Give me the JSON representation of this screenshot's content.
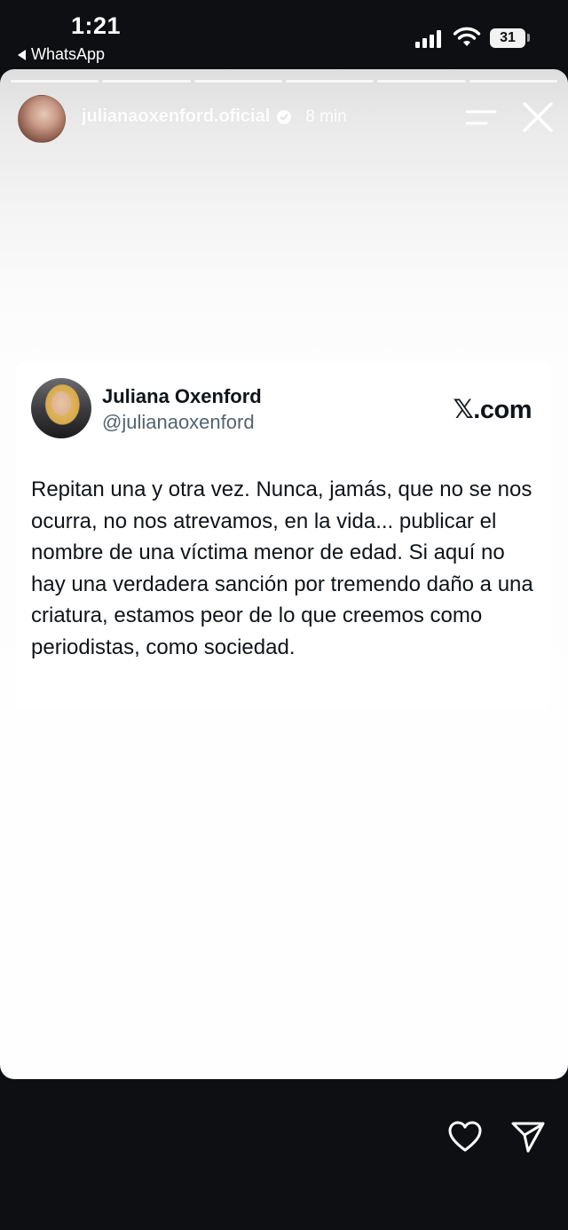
{
  "status_bar": {
    "time": "1:21",
    "back_app": "WhatsApp",
    "battery": "31",
    "icons": [
      "signal-icon",
      "wifi-icon",
      "battery-icon"
    ]
  },
  "story": {
    "progress_segments": 6,
    "username": "julianaoxenford.oficial",
    "time_ago": "8 min",
    "icons": [
      "verified-icon",
      "menu-icon",
      "close-icon"
    ]
  },
  "tweet": {
    "author_name": "Juliana Oxenford",
    "handle": "@julianaoxenford",
    "source": "𝕏.com",
    "text": "Repitan una y otra vez. Nunca, jamás, que no se nos ocurra, no nos atrevamos, en la vida... publicar el nombre de una víctima menor de edad. Si aquí no hay una verdadera sanción por tremendo daño a una criatura, estamos peor de lo que creemos como periodistas, como sociedad."
  },
  "actions": {
    "icons": [
      "heart-icon",
      "send-icon"
    ]
  },
  "colors": {
    "background": "#0d0f12",
    "card": "#ffffff",
    "text": "#0f1419",
    "handle": "#536471"
  }
}
